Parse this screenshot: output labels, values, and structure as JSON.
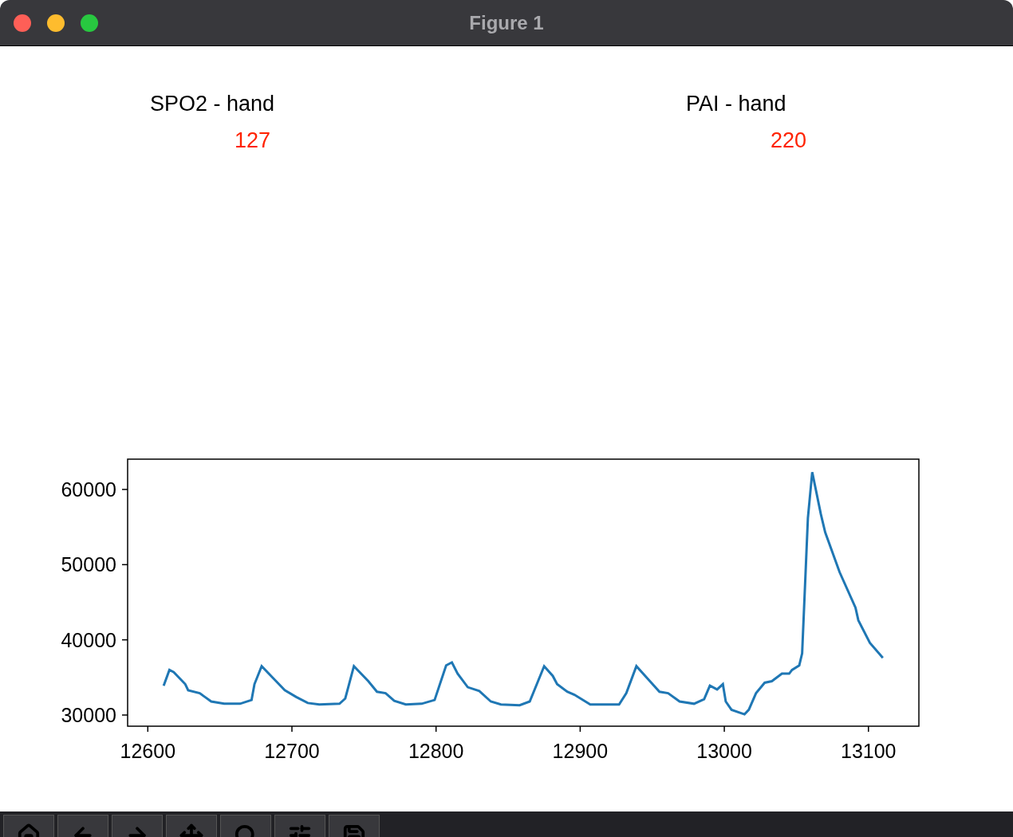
{
  "window": {
    "title": "Figure 1"
  },
  "panels": [
    {
      "title": "SPO2 - hand",
      "value": "127"
    },
    {
      "title": "PAI - hand",
      "value": "220"
    }
  ],
  "chart_data": {
    "type": "line",
    "xlim": [
      12586,
      13135
    ],
    "ylim": [
      28515,
      64030
    ],
    "xticks": [
      12600,
      12700,
      12800,
      12900,
      13000,
      13100
    ],
    "yticks": [
      30000,
      40000,
      50000,
      60000
    ],
    "x": [
      12611,
      12615,
      12618,
      12626,
      12628,
      12636,
      12644,
      12653,
      12664,
      12672,
      12674,
      12679,
      12689,
      12695,
      12703,
      12711,
      12719,
      12733,
      12737,
      12743,
      12753,
      12759,
      12765,
      12771,
      12779,
      12790,
      12799,
      12807,
      12811,
      12815,
      12822,
      12830,
      12838,
      12845,
      12858,
      12865,
      12875,
      12881,
      12884,
      12891,
      12896,
      12907,
      12927,
      12932,
      12939,
      12947,
      12955,
      12961,
      12969,
      12979,
      12986,
      12990,
      12995,
      12999,
      13001,
      13005,
      13014,
      13017,
      13022,
      13028,
      13033,
      13040,
      13045,
      13047,
      13052,
      13054,
      13058,
      13061,
      13067,
      13070,
      13080,
      13091,
      13093,
      13101,
      13110
    ],
    "series": [
      {
        "color": "#1f77b4",
        "values": [
          33900,
          36000,
          35700,
          34100,
          33300,
          32900,
          31800,
          31500,
          31500,
          32000,
          34100,
          36500,
          34500,
          33300,
          32400,
          31600,
          31400,
          31500,
          32200,
          36500,
          34500,
          33100,
          32900,
          31900,
          31400,
          31500,
          32000,
          36600,
          37000,
          35500,
          33700,
          33200,
          31800,
          31400,
          31300,
          31800,
          36500,
          35200,
          34100,
          33100,
          32700,
          31400,
          31400,
          32900,
          36500,
          34800,
          33100,
          32900,
          31800,
          31500,
          32100,
          33900,
          33400,
          34100,
          31800,
          30700,
          30100,
          30700,
          32900,
          34300,
          34500,
          35500,
          35500,
          36000,
          36600,
          38200,
          56200,
          62300,
          56700,
          54300,
          49000,
          44300,
          42600,
          39600,
          37600
        ]
      }
    ]
  }
}
